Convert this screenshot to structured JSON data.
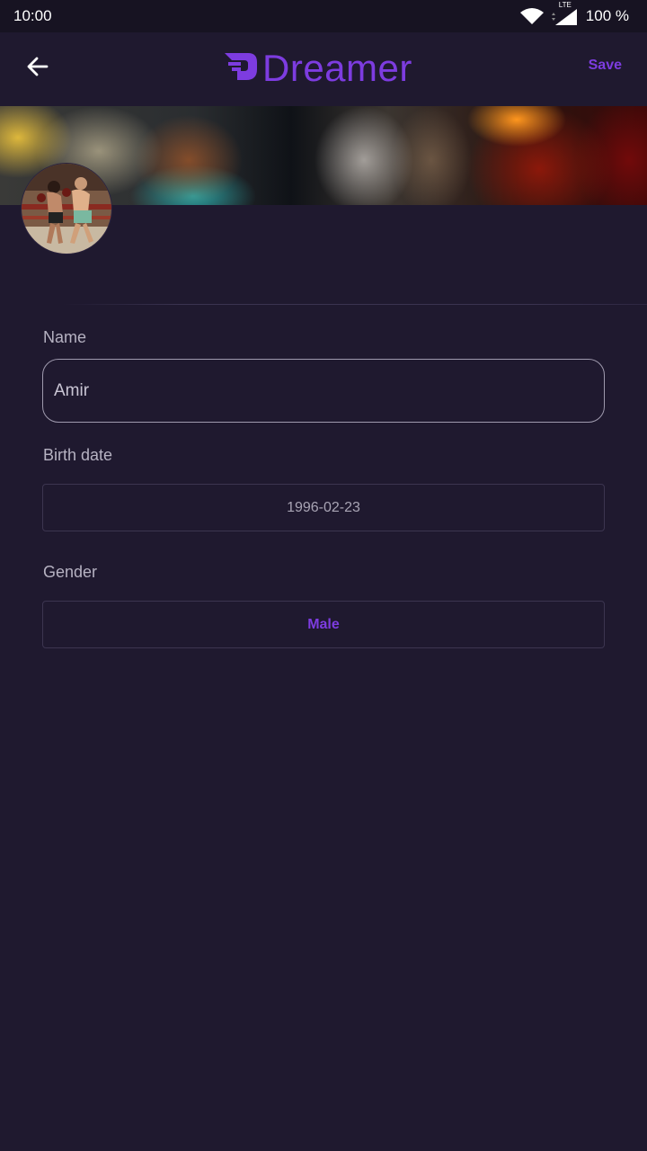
{
  "status_bar": {
    "time": "10:00",
    "network": "LTE",
    "battery": "100 %",
    "icons": [
      "wifi-icon",
      "signal-icon"
    ]
  },
  "app_bar": {
    "logo_text": "Dreamer",
    "save_label": "Save",
    "back_icon": "arrow-left-icon"
  },
  "profile": {
    "cover_image": "blurred-lights-photo",
    "avatar_image": "boxers-photo"
  },
  "form": {
    "name_label": "Name",
    "name_value": "Amir",
    "birth_label": "Birth date",
    "birth_value": "1996-02-23",
    "gender_label": "Gender",
    "gender_value": "Male"
  },
  "colors": {
    "accent": "#7d3ce0",
    "background": "#1f192f",
    "status_bar": "#171322"
  }
}
